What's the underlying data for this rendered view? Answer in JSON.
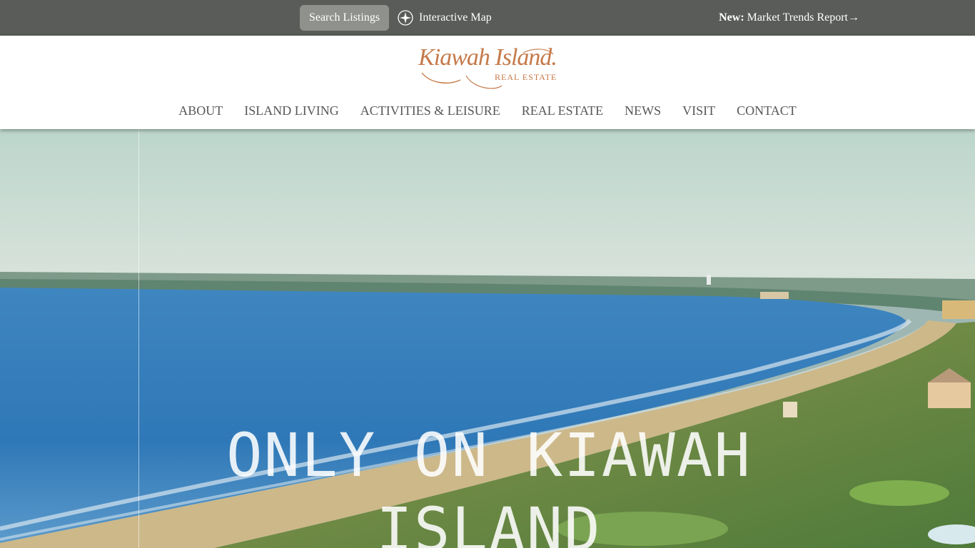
{
  "topbar": {
    "search_label": "Search Listings",
    "map_label": "Interactive Map",
    "trends_prefix": "New:",
    "trends_label": "Market Trends Report→",
    "map_icon": "compass-icon"
  },
  "header": {
    "logo_script": "Kiawah Island.",
    "logo_sub": "REAL ESTATE",
    "brand_color": "#c57a4a"
  },
  "nav": {
    "items": [
      "ABOUT",
      "ISLAND LIVING",
      "ACTIVITIES & LEISURE",
      "REAL ESTATE",
      "NEWS",
      "VISIT",
      "CONTACT"
    ]
  },
  "hero": {
    "title": "ONLY ON KIAWAH ISLAND"
  }
}
